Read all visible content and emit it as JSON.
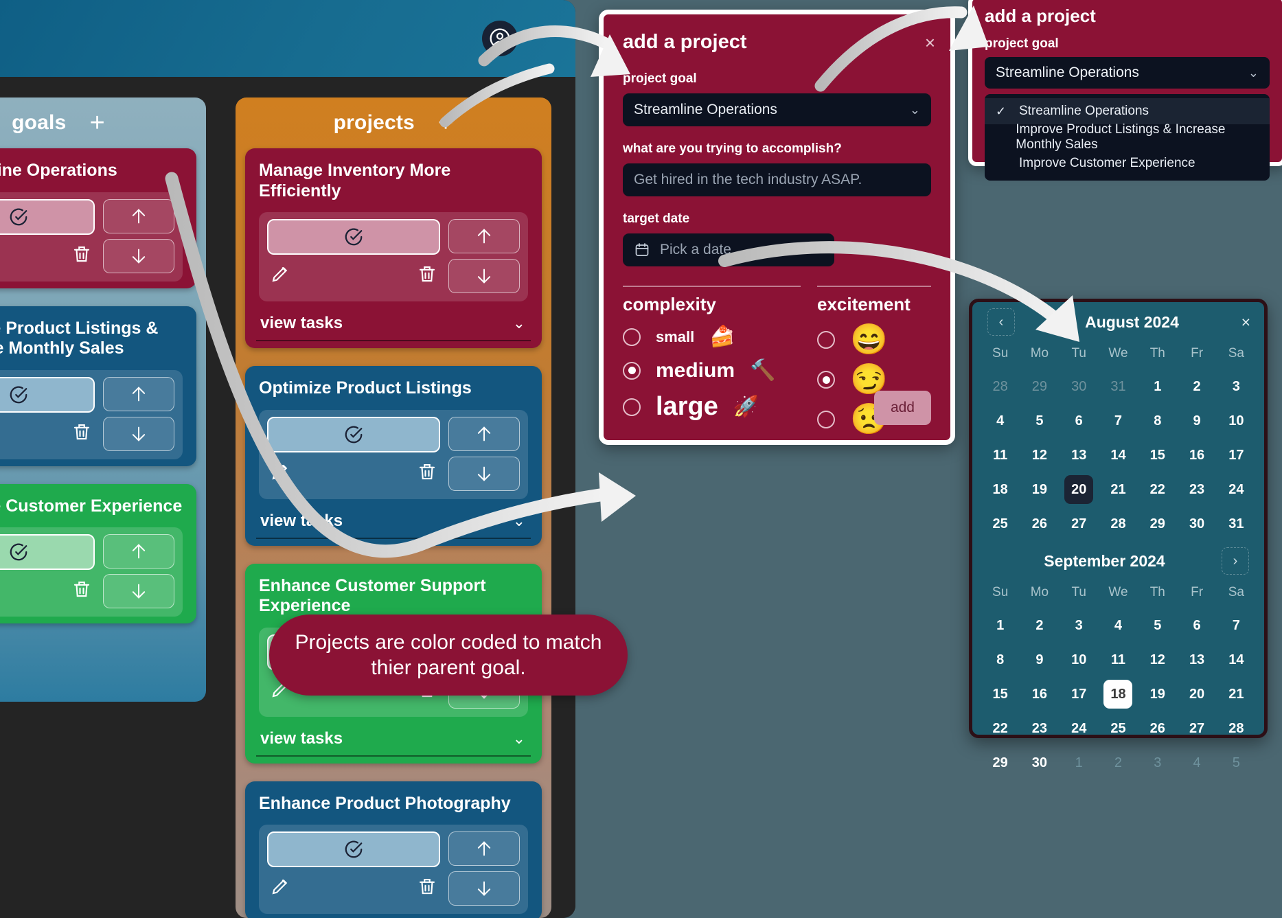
{
  "app": {
    "avatar_icon": "user-circle-icon",
    "background_color": "#4b6771",
    "header_color": "#176c90"
  },
  "goals_column": {
    "title": "goals",
    "add_label": "+",
    "cards": [
      {
        "title": "Streamline Operations",
        "color": "#8b1235"
      },
      {
        "title": "Improve Product Listings & Increase Monthly Sales",
        "color": "#13567f"
      },
      {
        "title": "Improve Customer Experience",
        "color": "#1faa4d"
      }
    ]
  },
  "projects_column": {
    "title": "projects",
    "add_label": "+",
    "view_tasks_label": "view tasks",
    "chevron": "⌄",
    "cards": [
      {
        "title": "Manage Inventory More Efficiently",
        "color": "#8b1235"
      },
      {
        "title": "Optimize Product Listings",
        "color": "#13567f"
      },
      {
        "title": "Enhance Customer Support Experience",
        "color": "#1faa4d"
      },
      {
        "title": "Enhance Product Photography",
        "color": "#13567f"
      }
    ]
  },
  "add_project_modal": {
    "title": "add a project",
    "close_label": "×",
    "goal_label": "project goal",
    "goal_value": "Streamline Operations",
    "goal_chevron": "⌄",
    "accomplish_label": "what are you trying to accomplish?",
    "accomplish_placeholder": "Get hired in the tech industry ASAP.",
    "target_date_label": "target date",
    "date_placeholder": "Pick a date",
    "complexity_label": "complexity",
    "complexity_options": [
      {
        "label": "small",
        "emoji": "🍰",
        "selected": false
      },
      {
        "label": "medium",
        "emoji": "🔨",
        "selected": true
      },
      {
        "label": "large",
        "emoji": "🚀",
        "selected": false
      }
    ],
    "excitement_label": "excitement",
    "excitement_options": [
      {
        "emoji": "😄",
        "selected": false
      },
      {
        "emoji": "😏",
        "selected": true
      },
      {
        "emoji": "😟",
        "selected": false
      }
    ],
    "add_label": "add"
  },
  "goal_dropdown_popup": {
    "title": "add a project",
    "field_label": "project goal",
    "selected_value": "Streamline Operations",
    "chevron": "⌄",
    "check": "✓",
    "options": [
      {
        "label": "Streamline Operations",
        "selected": true
      },
      {
        "label": "Improve Product Listings & Increase Monthly Sales",
        "selected": false
      },
      {
        "label": "Improve Customer Experience",
        "selected": false
      }
    ]
  },
  "calendar_popup": {
    "close_label": "×",
    "prev_label": "‹",
    "next_label": "›",
    "background_color": "#1d5c6e",
    "weekdays": [
      "Su",
      "Mo",
      "Tu",
      "We",
      "Th",
      "Fr",
      "Sa"
    ],
    "months": [
      {
        "title": "August 2024",
        "today": 20,
        "selected": null,
        "cells": [
          {
            "d": "28",
            "mute": true
          },
          {
            "d": "29",
            "mute": true
          },
          {
            "d": "30",
            "mute": true
          },
          {
            "d": "31",
            "mute": true
          },
          {
            "d": "1"
          },
          {
            "d": "2"
          },
          {
            "d": "3"
          },
          {
            "d": "4"
          },
          {
            "d": "5"
          },
          {
            "d": "6"
          },
          {
            "d": "7"
          },
          {
            "d": "8"
          },
          {
            "d": "9"
          },
          {
            "d": "10"
          },
          {
            "d": "11"
          },
          {
            "d": "12"
          },
          {
            "d": "13"
          },
          {
            "d": "14"
          },
          {
            "d": "15"
          },
          {
            "d": "16"
          },
          {
            "d": "17"
          },
          {
            "d": "18"
          },
          {
            "d": "19"
          },
          {
            "d": "20",
            "today": true
          },
          {
            "d": "21"
          },
          {
            "d": "22"
          },
          {
            "d": "23"
          },
          {
            "d": "24"
          },
          {
            "d": "25"
          },
          {
            "d": "26"
          },
          {
            "d": "27"
          },
          {
            "d": "28"
          },
          {
            "d": "29"
          },
          {
            "d": "30"
          },
          {
            "d": "31"
          }
        ]
      },
      {
        "title": "September 2024",
        "today": null,
        "selected": 18,
        "cells": [
          {
            "d": "1"
          },
          {
            "d": "2"
          },
          {
            "d": "3"
          },
          {
            "d": "4"
          },
          {
            "d": "5"
          },
          {
            "d": "6"
          },
          {
            "d": "7"
          },
          {
            "d": "8"
          },
          {
            "d": "9"
          },
          {
            "d": "10"
          },
          {
            "d": "11"
          },
          {
            "d": "12"
          },
          {
            "d": "13"
          },
          {
            "d": "14"
          },
          {
            "d": "15"
          },
          {
            "d": "16"
          },
          {
            "d": "17"
          },
          {
            "d": "18",
            "selected": true
          },
          {
            "d": "19"
          },
          {
            "d": "20"
          },
          {
            "d": "21"
          },
          {
            "d": "22"
          },
          {
            "d": "23"
          },
          {
            "d": "24"
          },
          {
            "d": "25"
          },
          {
            "d": "26"
          },
          {
            "d": "27"
          },
          {
            "d": "28"
          },
          {
            "d": "29"
          },
          {
            "d": "30"
          },
          {
            "d": "1",
            "mute": true
          },
          {
            "d": "2",
            "mute": true
          },
          {
            "d": "3",
            "mute": true
          },
          {
            "d": "4",
            "mute": true
          },
          {
            "d": "5",
            "mute": true
          }
        ]
      }
    ]
  },
  "tooltip": {
    "text": "Projects are color coded to match thier parent goal."
  }
}
